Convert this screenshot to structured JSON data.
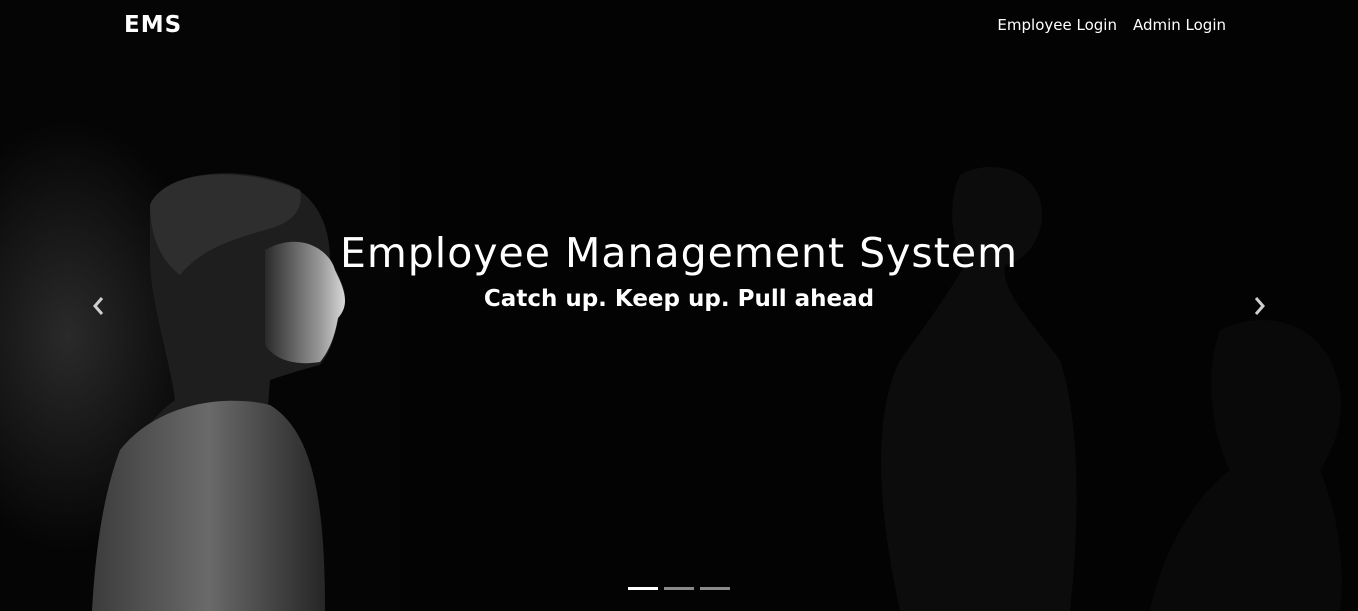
{
  "navbar": {
    "brand": "EMS",
    "links": [
      {
        "label": "Employee Login"
      },
      {
        "label": "Admin Login"
      }
    ]
  },
  "carousel": {
    "title": "Employee Management System",
    "subtitle": "Catch up. Keep up. Pull ahead",
    "slide_count": 3,
    "active_slide": 1
  },
  "icons": {
    "prev": "chevron-left-icon",
    "next": "chevron-right-icon"
  },
  "colors": {
    "background": "#000000",
    "text": "#ffffff",
    "indicator_inactive": "#8a8a8a"
  }
}
